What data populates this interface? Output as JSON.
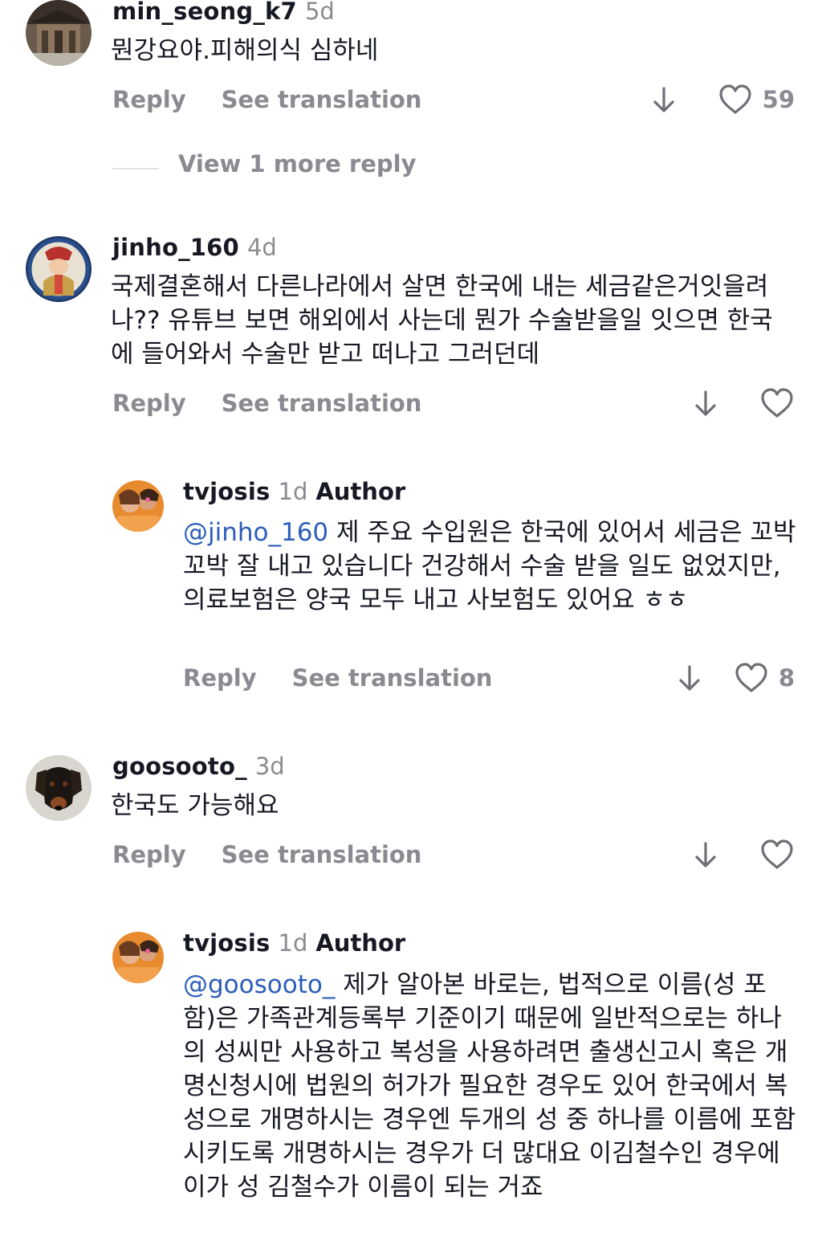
{
  "actions": {
    "reply": "Reply",
    "translate": "See translation"
  },
  "comments": [
    {
      "username": "min_seong_k7",
      "age": "5d",
      "text": "뭔강요야.피해의식 심하네",
      "likes": "59",
      "more": "View 1 more reply"
    },
    {
      "username": "jinho_160",
      "age": "4d",
      "text": "국제결혼해서 다른나라에서 살면 한국에 내는 세금같은거잇을려나?? 유튜브 보면 해외에서 사는데 뭔가 수술받을일 잇으면 한국에 들어와서 수술만 받고 떠나고 그러던데",
      "likes": ""
    },
    {
      "username": "tvjosis",
      "age": "1d",
      "badge": "Author",
      "mention": "@jinho_160",
      "text": " 제 주요 수입원은 한국에 있어서 세금은 꼬박꼬박 잘 내고 있습니다 건강해서 수술 받을 일도 없었지만, 의료보험은 양국 모두 내고 사보험도 있어요 ㅎㅎ",
      "likes": "8"
    },
    {
      "username": "goosooto_",
      "age": "3d",
      "text": "한국도 가능해요",
      "likes": ""
    },
    {
      "username": "tvjosis",
      "age": "1d",
      "badge": "Author",
      "mention": "@goosooto_",
      "text": " 제가 알아본 바로는, 법적으로 이름(성 포함)은 가족관계등록부 기준이기 때문에 일반적으로는 하나의 성씨만 사용하고 복성을 사용하려면 출생신고시 혹은 개명신청시에 법원의 허가가 필요한 경우도 있어 한국에서 복성으로 개명하시는 경우엔 두개의 성 중 하나를 이름에 포함시키도록 개명하시는 경우가 더 많대요 이김철수인 경우에 이가 성 김철수가 이름이 되는 거죠"
    }
  ],
  "icons": {
    "down": "arrow-down-icon",
    "like": "heart-outline-icon"
  },
  "colors": {
    "mention": "#2b5db9",
    "secondary": "#8a8b91",
    "text": "#161823"
  }
}
